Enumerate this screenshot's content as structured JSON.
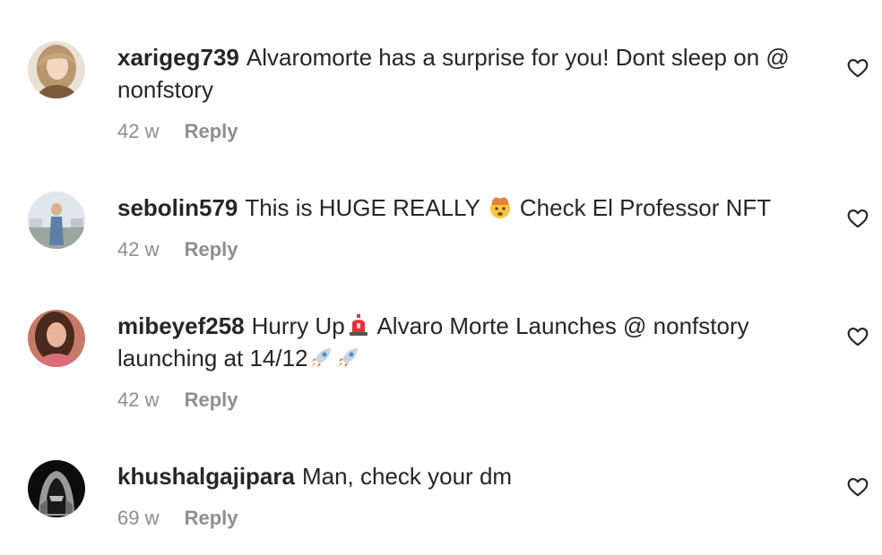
{
  "comments": [
    {
      "username": "xarigeg739",
      "text_before": "Alvaromorte has a surprise for you! Dont sleep on @ nonfstory",
      "time": "42 w",
      "reply_label": "Reply",
      "avatar_icon": "profile-photo"
    },
    {
      "username": "sebolin579",
      "text_before": "This is HUGE REALLY",
      "emoji_1": "exploding-head-emoji",
      "text_after": "Check El Professor NFT",
      "time": "42 w",
      "reply_label": "Reply",
      "avatar_icon": "profile-photo"
    },
    {
      "username": "mibeyef258",
      "text_before": "Hurry Up",
      "emoji_1": "police-light-emoji",
      "text_after": "Alvaro Morte Launches @ nonfstory launching at 14/12",
      "emoji_2": "rocket-emoji",
      "time": "42 w",
      "reply_label": "Reply",
      "avatar_icon": "profile-photo"
    },
    {
      "username": "khushalgajipara",
      "text_before": "Man, check your dm",
      "time": "69 w",
      "reply_label": "Reply",
      "avatar_icon": "hooded-figure-avatar"
    }
  ],
  "icons": {
    "like": "heart-outline-icon"
  },
  "colors": {
    "text": "#262626",
    "muted": "#8e8e8e"
  }
}
